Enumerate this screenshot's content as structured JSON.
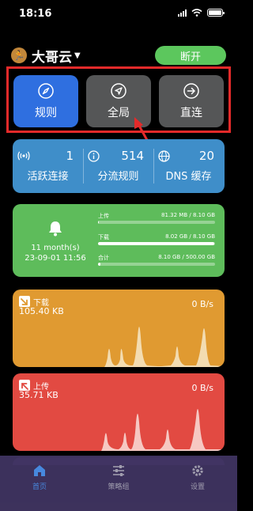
{
  "status_bar": {
    "time": "18:16"
  },
  "header": {
    "profile_name": "大哥云",
    "disconnect_label": "断开"
  },
  "modes": [
    {
      "label": "规则",
      "icon": "compass-icon",
      "selected": true,
      "color": "#2f6fe0"
    },
    {
      "label": "全局",
      "icon": "navigation-icon",
      "selected": false,
      "color": "#555657"
    },
    {
      "label": "直连",
      "icon": "arrow-right-circle-icon",
      "selected": false,
      "color": "#555657"
    }
  ],
  "highlight_color": "#e42a2a",
  "stats": [
    {
      "icon": "antenna-icon",
      "value": "1",
      "label": "活跃连接"
    },
    {
      "icon": "info-icon",
      "value": "514",
      "label": "分流规则"
    },
    {
      "icon": "globe-icon",
      "value": "20",
      "label": "DNS 缓存"
    }
  ],
  "usage": {
    "duration": "11 month(s)",
    "expiry": "23-09-01 11:56",
    "rows": [
      {
        "label": "上传",
        "value": "81.32 MB / 8.10 GB",
        "fraction": 0.01
      },
      {
        "label": "下载",
        "value": "8.02 GB / 8.10 GB",
        "fraction": 0.99
      },
      {
        "label": "合计",
        "value": "8.10 GB / 500.00 GB",
        "fraction": 0.02
      }
    ]
  },
  "download": {
    "title": "下载",
    "total": "105.40 KB",
    "rate": "0 B/s",
    "color": "#e09a31"
  },
  "upload": {
    "title": "上传",
    "total": "35.71 KB",
    "rate": "0 B/s",
    "color": "#e24a42"
  },
  "tabs": [
    {
      "label": "首页",
      "icon": "home-icon",
      "active": true
    },
    {
      "label": "策略组",
      "icon": "sliders-icon",
      "active": false
    },
    {
      "label": "设置",
      "icon": "gear-icon",
      "active": false
    }
  ]
}
